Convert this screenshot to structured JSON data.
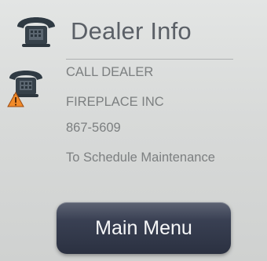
{
  "header": {
    "title": "Dealer Info",
    "icon": "telephone-icon"
  },
  "contact": {
    "icon": "telephone-warning-icon",
    "lines": [
      "CALL DEALER",
      "FIREPLACE INC",
      "867-5609",
      "To Schedule Maintenance"
    ]
  },
  "actions": {
    "main_menu_label": "Main Menu"
  },
  "colors": {
    "accent": "#2f3647",
    "text_dark": "#5b6067",
    "text_light": "#7c7f80",
    "warning": "#f28b2a"
  }
}
